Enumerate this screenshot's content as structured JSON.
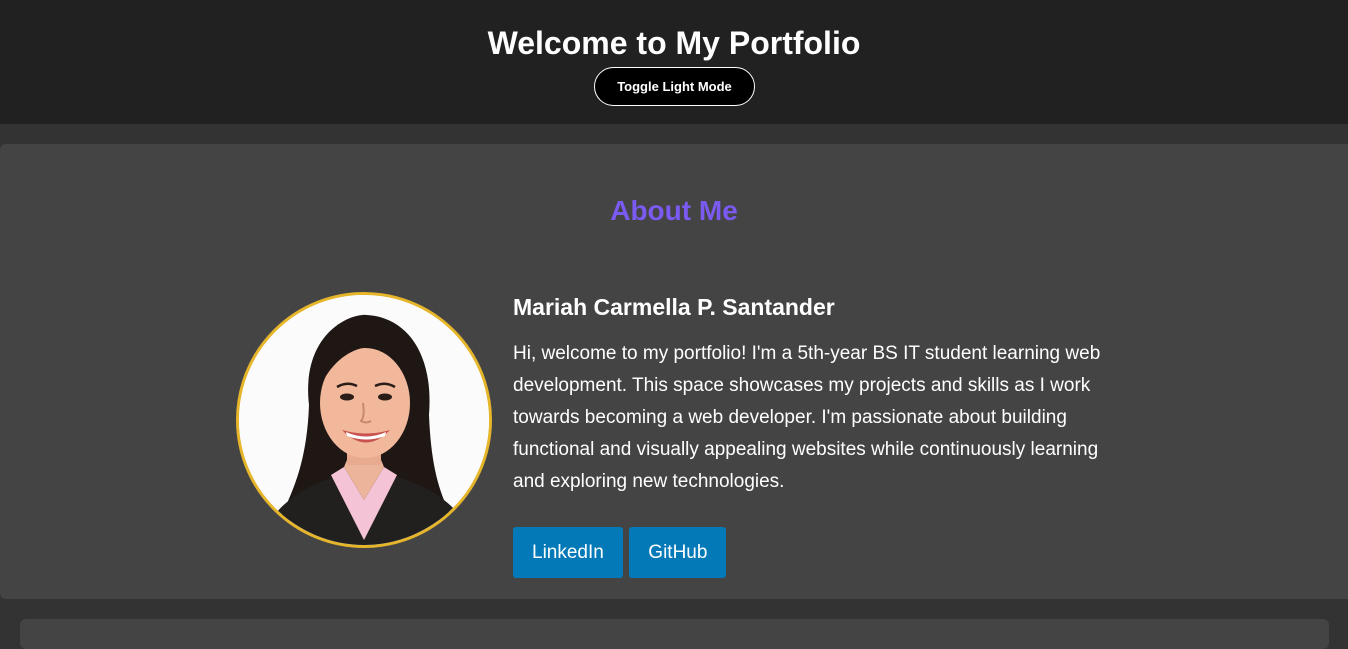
{
  "header": {
    "title": "Welcome to My Portfolio",
    "toggle_label": "Toggle Light Mode"
  },
  "about": {
    "heading": "About Me",
    "name": "Mariah Carmella P. Santander",
    "bio": "Hi, welcome to my portfolio! I'm a 5th-year BS IT student learning web development. This space showcases my projects and skills as I work towards becoming a web developer. I'm passionate about building functional and visually appealing websites while continuously learning and exploring new technologies.",
    "links": [
      {
        "label": "LinkedIn"
      },
      {
        "label": "GitHub"
      }
    ]
  },
  "colors": {
    "header_bg": "#212121",
    "page_bg": "#333333",
    "card_bg": "#444444",
    "accent_heading": "#7a5af0",
    "photo_border": "#e5b52a",
    "link_button_bg": "#0379b8"
  }
}
